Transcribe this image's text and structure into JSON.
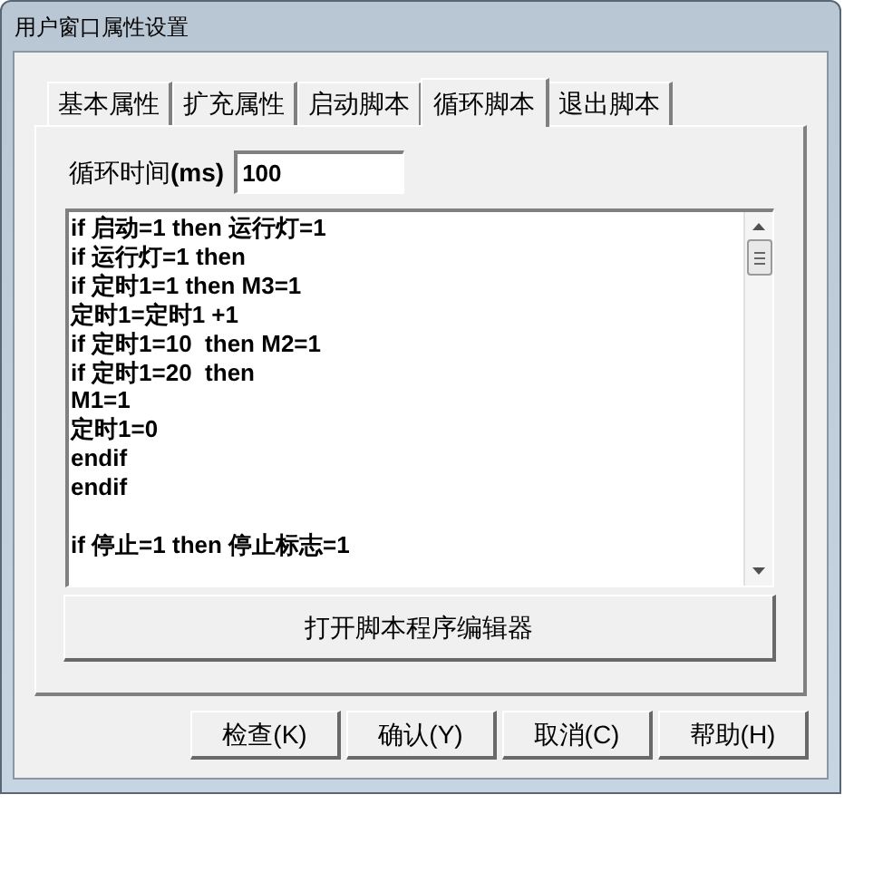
{
  "window": {
    "title": "用户窗口属性设置"
  },
  "tabs": [
    {
      "label": "基本属性",
      "selected": false
    },
    {
      "label": "扩充属性",
      "selected": false
    },
    {
      "label": "启动脚本",
      "selected": false
    },
    {
      "label": "循环脚本",
      "selected": true
    },
    {
      "label": "退出脚本",
      "selected": false
    }
  ],
  "cycle_time": {
    "label": "循环时间**(ms)**",
    "value": "100"
  },
  "script": {
    "code": "if 启动=1 then 运行灯=1\nif 运行灯=1 then\nif 定时1=1 then M3=1\n定时1=定时1 +1\nif 定时1=10  then M2=1\nif 定时1=20  then\nM1=1\n定时1=0\nendif\nendif\n\nif 停止=1 then 停止标志=1"
  },
  "editor_button": "打开脚本程序编辑器",
  "buttons": [
    "检查(K)",
    "确认(Y)",
    "取消(C)",
    "帮助(H)"
  ]
}
